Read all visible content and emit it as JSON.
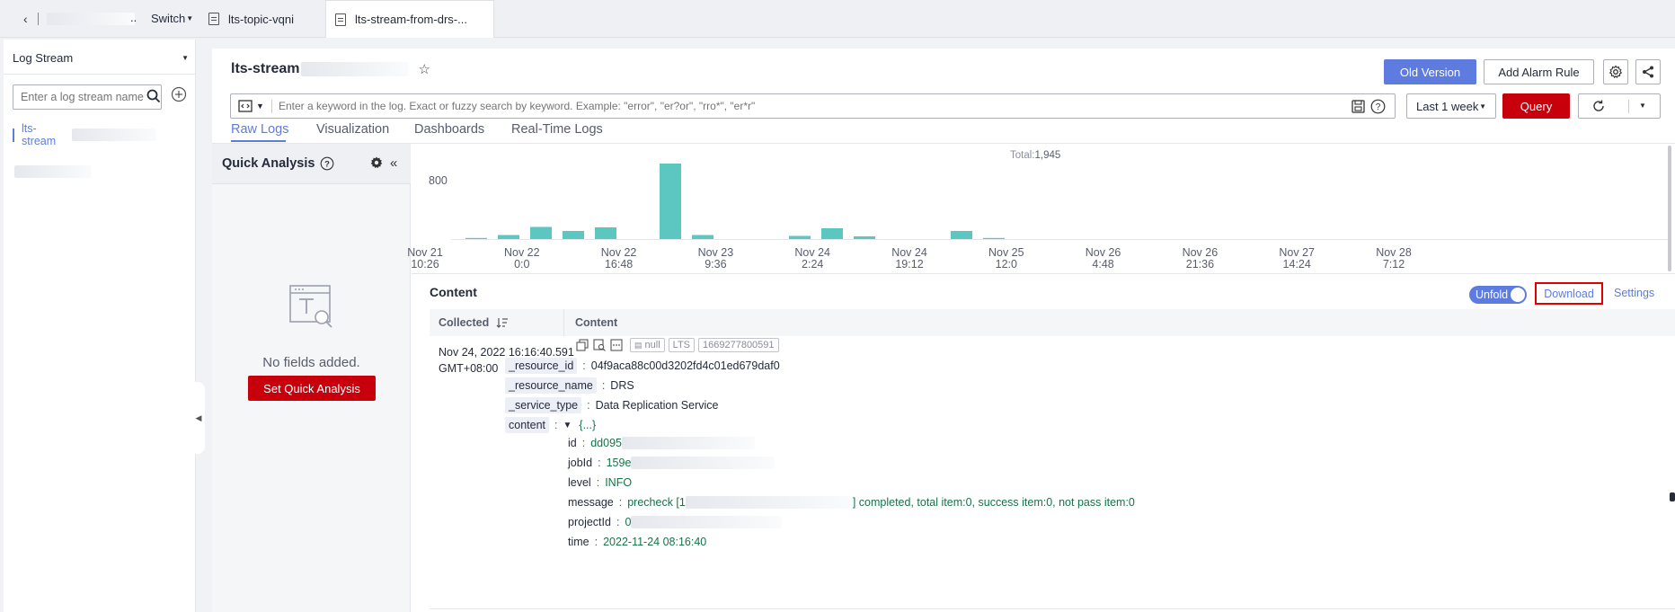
{
  "tabs": {
    "switch_label": "Switch",
    "items": [
      {
        "label": "lts-topic-vqni"
      },
      {
        "label": "lts-stream-from-drs-..."
      }
    ]
  },
  "sidebar": {
    "dropdown_label": "Log Stream",
    "search_placeholder": "Enter a log stream name",
    "stream_item_label": "lts-stream"
  },
  "header": {
    "title": "lts-stream",
    "old_version_label": "Old Version",
    "add_alarm_label": "Add Alarm Rule"
  },
  "search": {
    "placeholder": "Enter a keyword in the log. Exact or fuzzy search by keyword. Example: \"error\", \"er?or\", \"rro*\", \"er*r\"",
    "time_range": "Last 1 week",
    "query_label": "Query"
  },
  "subtabs": [
    {
      "label": "Raw Logs"
    },
    {
      "label": "Visualization"
    },
    {
      "label": "Dashboards"
    },
    {
      "label": "Real-Time Logs"
    }
  ],
  "quick_analysis": {
    "title": "Quick Analysis",
    "empty_text": "No fields added.",
    "set_button_label": "Set Quick Analysis"
  },
  "chart_data": {
    "type": "bar",
    "title": "",
    "total_label": "Total:",
    "total_value": "1,945",
    "ytick_label": "800",
    "ylim": [
      0,
      1000
    ],
    "x_ticks": [
      [
        "Nov 21",
        "10:26"
      ],
      [
        "Nov 22",
        "0:0"
      ],
      [
        "Nov 22",
        "16:48"
      ],
      [
        "Nov 23",
        "9:36"
      ],
      [
        "Nov 24",
        "2:24"
      ],
      [
        "Nov 24",
        "19:12"
      ],
      [
        "Nov 25",
        "12:0"
      ],
      [
        "Nov 26",
        "4:48"
      ],
      [
        "Nov 26",
        "21:36"
      ],
      [
        "Nov 27",
        "14:24"
      ],
      [
        "Nov 28",
        "7:12"
      ]
    ],
    "values": [
      12,
      45,
      135,
      90,
      130,
      0,
      840,
      45,
      0,
      0,
      35,
      120,
      30,
      0,
      0,
      90,
      10,
      0,
      0,
      0,
      0,
      0,
      0,
      0,
      0,
      0,
      0,
      0,
      0,
      0,
      0,
      0
    ],
    "color": "#5cc6c1"
  },
  "content": {
    "title": "Content",
    "unfold_label": "Unfold",
    "download_label": "Download",
    "settings_label": "Settings",
    "col_collected": "Collected",
    "col_content": "Content",
    "row": {
      "collected_line1": "Nov 24, 2022 16:16:40.591",
      "collected_line2": "GMT+08:00",
      "tag_null": "null",
      "tag_lts": "LTS",
      "tag_ts": "1669277800591",
      "fields": [
        {
          "key": "_resource_id",
          "value": "04f9aca88c00d3202fd4c01ed679daf0"
        },
        {
          "key": "_resource_name",
          "value": "DRS"
        },
        {
          "key": "_service_type",
          "value": "Data Replication Service"
        },
        {
          "key": "content",
          "value": "{...}"
        }
      ],
      "nested": [
        {
          "key": "id",
          "value": "dd095"
        },
        {
          "key": "jobId",
          "value": "159e"
        },
        {
          "key": "level",
          "value": "INFO"
        },
        {
          "key": "message",
          "value_prefix": "precheck [1",
          "value_suffix": "] completed, total item:0, success item:0, not pass item:0"
        },
        {
          "key": "projectId",
          "value": "0"
        },
        {
          "key": "time",
          "value": "2022-11-24 08:16:40"
        }
      ]
    }
  }
}
